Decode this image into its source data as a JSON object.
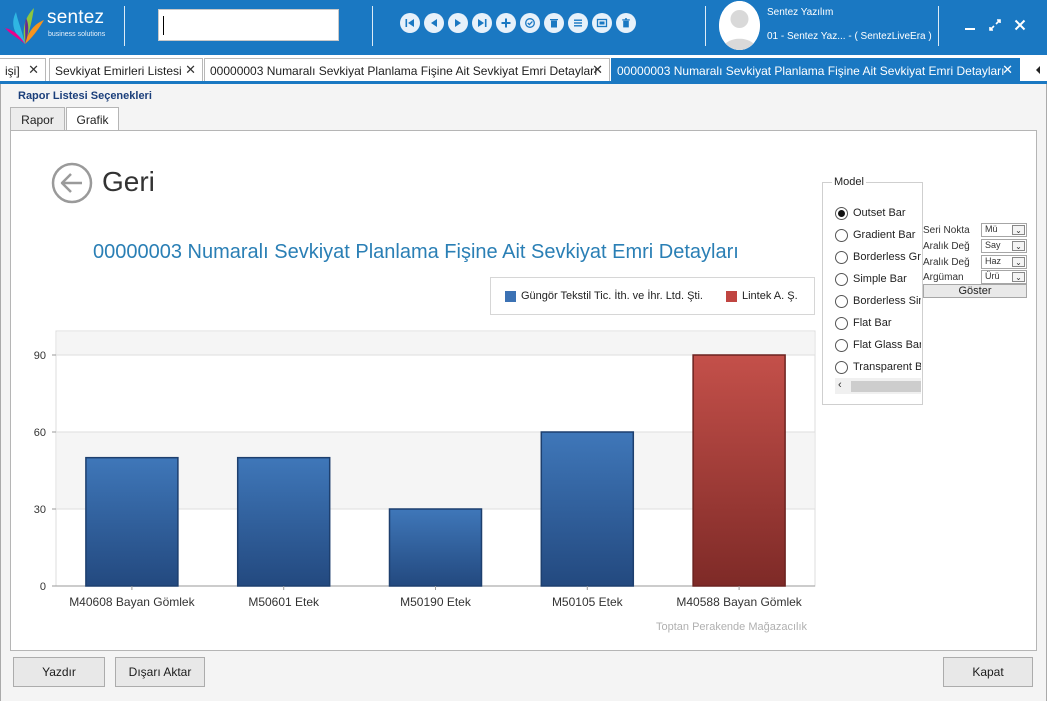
{
  "app": {
    "brand": "sentez",
    "brand_sub": "business solutions"
  },
  "search": {
    "value": "",
    "placeholder": ""
  },
  "toolbar_icons": [
    "first-icon",
    "previous-icon",
    "next-icon",
    "last-icon",
    "add-icon",
    "approve-icon",
    "delete-icon",
    "list-icon",
    "preview-icon",
    "trash-icon"
  ],
  "user": {
    "name": "Sentez Yazılım",
    "company": "01 - Sentez Yaz... - ( SentezLiveEra )"
  },
  "tabs": [
    {
      "label": "işi]",
      "active": false
    },
    {
      "label": "Sevkiyat Emirleri Listesi",
      "active": false
    },
    {
      "label": "00000003 Numaralı Sevkiyat Planlama Fişine Ait Sevkiyat Emri Detayları",
      "active": false
    },
    {
      "label": "00000003 Numaralı Sevkiyat Planlama Fişine Ait Sevkiyat Emri Detayları",
      "active": true
    }
  ],
  "panel": {
    "report_options": "Rapor Listesi Seçenekleri",
    "subtabs": [
      "Rapor",
      "Grafik"
    ],
    "back_label": "Geri",
    "footer_note": "Toptan Perakende Mağazacılık"
  },
  "model": {
    "title": "Model",
    "options": [
      "Outset Bar",
      "Gradient Bar",
      "Borderless Gradient Bar",
      "Simple Bar",
      "Borderless Simple Bar",
      "Flat Bar",
      "Flat Glass Bar",
      "Transparent Bar"
    ],
    "selected": "Outset Bar"
  },
  "settings": {
    "rows": [
      {
        "label": "Seri Nokta",
        "value": "Mü"
      },
      {
        "label": "Aralık Değ",
        "value": "Say"
      },
      {
        "label": "Aralık Değ",
        "value": "Haz"
      },
      {
        "label": "Argüman",
        "value": "Ürü"
      }
    ],
    "show_button": "Göster"
  },
  "buttons": {
    "print": "Yazdır",
    "export": "Dışarı Aktar",
    "close": "Kapat"
  },
  "colors": {
    "accent": "#1a78c2",
    "series_1": "#2f5f9e",
    "series_2": "#a8403c",
    "title": "#2a7fb5"
  },
  "chart_data": {
    "type": "bar",
    "title": "00000003 Numaralı Sevkiyat Planlama Fişine Ait Sevkiyat Emri Detayları",
    "categories": [
      "M40608 Bayan Gömlek",
      "M50601 Etek",
      "M50190 Etek",
      "M50105 Etek",
      "M40588 Bayan Gömlek"
    ],
    "series": [
      {
        "name": "Güngör Tekstil Tic. İth. ve İhr. Ltd. Şti.",
        "values": [
          50,
          50,
          30,
          60,
          null
        ]
      },
      {
        "name": "Lintek A. Ş.",
        "values": [
          null,
          null,
          null,
          null,
          90
        ]
      }
    ],
    "yticks": [
      0,
      30,
      60,
      90
    ],
    "ylim": [
      0,
      90
    ],
    "legend_position": "top-right",
    "grid": true
  }
}
